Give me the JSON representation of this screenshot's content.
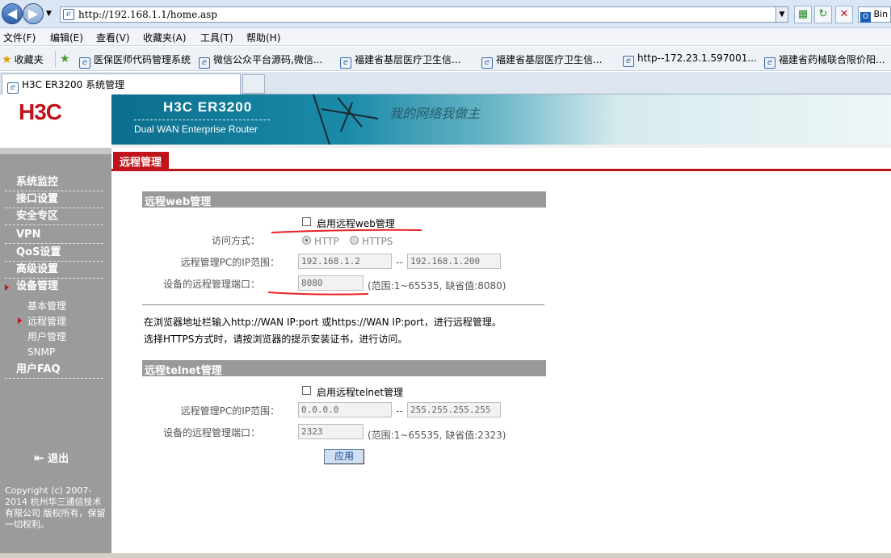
{
  "browser": {
    "address": "http://192.168.1.1/home.asp",
    "menu": [
      "文件(F)",
      "编辑(E)",
      "查看(V)",
      "收藏夹(A)",
      "工具(T)",
      "帮助(H)"
    ],
    "favorites_label": "收藏夹",
    "favorites": [
      "医保医师代码管理系统",
      "微信公众平台源码,微信...",
      "福建省基层医疗卫生信...",
      "福建省基层医疗卫生信...",
      "http--172.23.1.597001...",
      "福建省药械联合限价阳..."
    ],
    "tab_title": "H3C  ER3200  系统管理",
    "right_text": "Bin"
  },
  "banner": {
    "logo": "H3C",
    "model": "H3C  ER3200",
    "subtitle": "Dual WAN Enterprise Router",
    "slogan": "我的网络我做主"
  },
  "sidebar": {
    "items": [
      "系统监控",
      "接口设置",
      "安全专区",
      "VPN",
      "QoS设置",
      "高级设置",
      "设备管理"
    ],
    "subitems": [
      "基本管理",
      "远程管理",
      "用户管理",
      "SNMP"
    ],
    "faq": "用户FAQ",
    "logout": "退出",
    "copyright": "Copyright (c) 2007-2014  杭州华三通信技术有限公司 版权所有，保留一切权利。"
  },
  "page": {
    "tab": "远程管理",
    "web": {
      "title": "远程web管理",
      "enable_label": "启用远程web管理",
      "access_label": "访问方式：",
      "http": "HTTP",
      "https": "HTTPS",
      "ip_label": "远程管理PC的IP范围：",
      "ip_from": "192.168.1.2",
      "ip_to": "192.168.1.200",
      "port_label": "设备的远程管理端口：",
      "port": "8080",
      "port_hint": "(范围:1~65535, 缺省值:8080)",
      "range_sep": "--"
    },
    "note1": "在浏览器地址栏输入http://WAN IP:port 或https://WAN IP:port，进行远程管理。",
    "note2": "选择HTTPS方式时，请按浏览器的提示安装证书，进行访问。",
    "telnet": {
      "title": "远程telnet管理",
      "enable_label": "启用远程telnet管理",
      "ip_label": "远程管理PC的IP范围：",
      "ip_from": "0.0.0.0",
      "ip_to": "255.255.255.255",
      "port_label": "设备的远程管理端口：",
      "port": "2323",
      "port_hint": "(范围:1~65535, 缺省值:2323)",
      "range_sep": "--"
    },
    "apply": "应用"
  },
  "colors": {
    "accent": "#c0141c",
    "sidebar": "#9b9b9b",
    "section_header": "#999999"
  }
}
